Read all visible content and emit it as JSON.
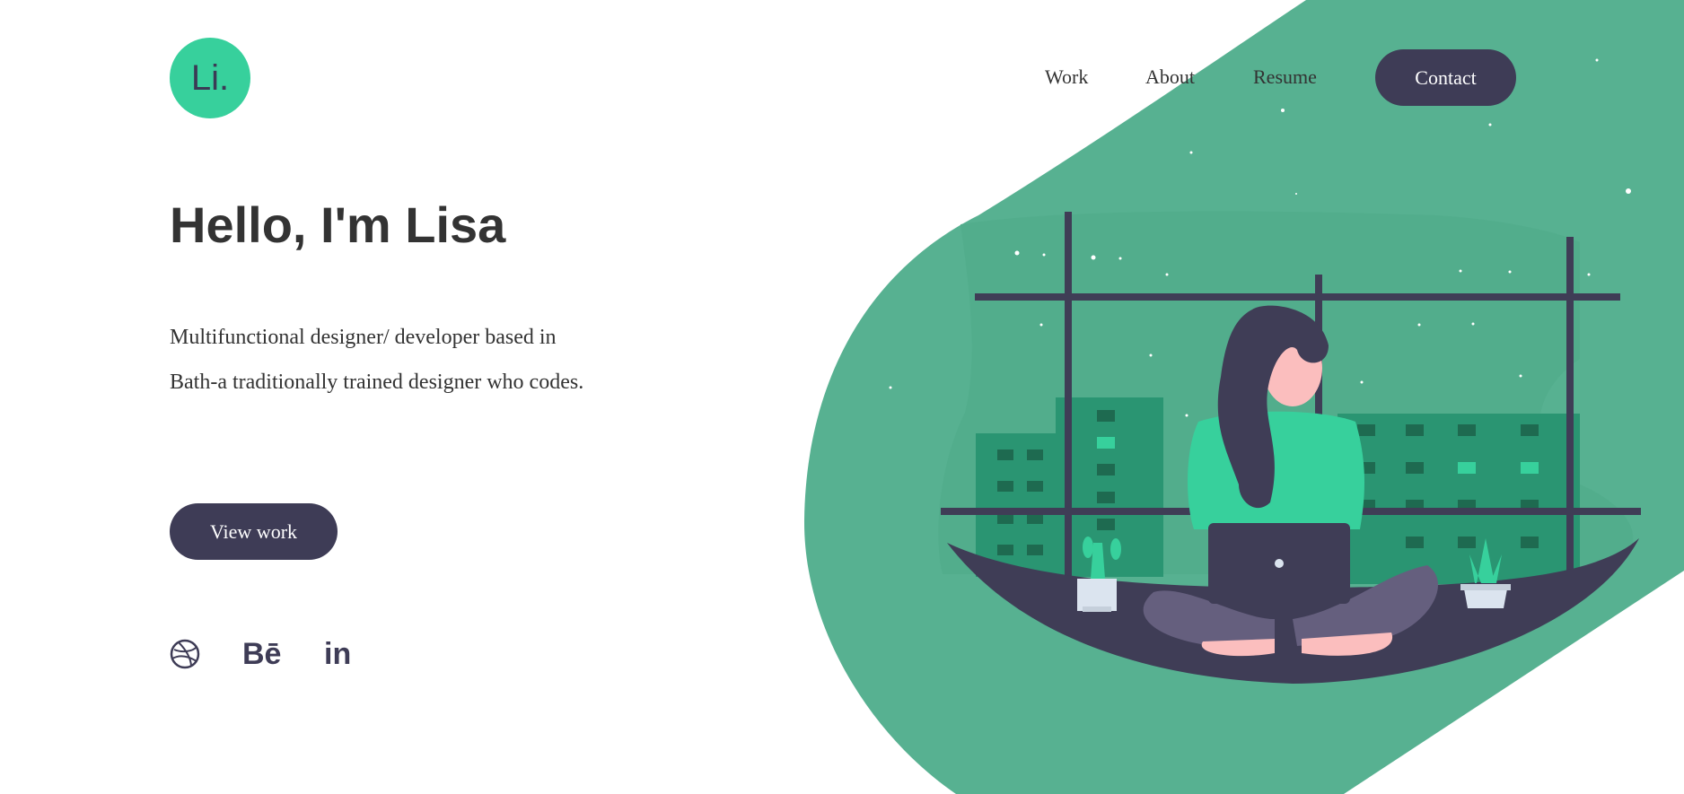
{
  "brand": {
    "logo_text": "Li."
  },
  "nav": {
    "items": [
      {
        "label": "Work"
      },
      {
        "label": "About"
      },
      {
        "label": "Resume"
      }
    ],
    "contact_label": "Contact"
  },
  "hero": {
    "title": "Hello, I'm Lisa",
    "description": "Multifunctional designer/ developer based in Bath-a traditionally trained designer who codes.",
    "cta_label": "View work"
  },
  "social": {
    "dribbble_icon": "dribbble-icon",
    "behance_label": "Bē",
    "linkedin_label": "in"
  },
  "colors": {
    "accent": "#37d09c",
    "dark": "#3e3c56",
    "blob": "#57b191",
    "window_dark": "#3f3d56"
  }
}
